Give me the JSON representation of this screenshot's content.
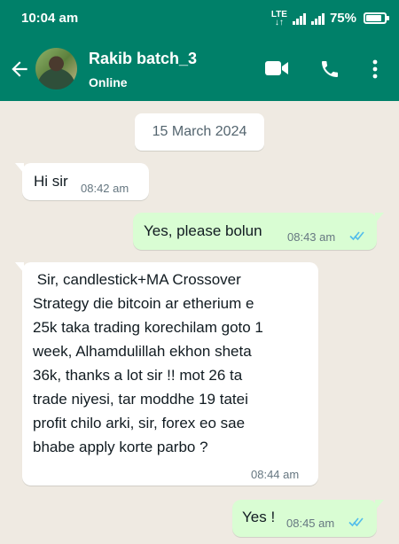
{
  "status_bar": {
    "time": "10:04 am",
    "network": "LTE",
    "battery": "75%",
    "battery_level": 0.75
  },
  "header": {
    "contact_name": "Rakib batch_3",
    "contact_status": "Online",
    "icons": [
      "back-arrow-icon",
      "video-call-icon",
      "phone-icon",
      "more-vertical-icon"
    ],
    "bar_color": "#008069"
  },
  "chat": {
    "date_label": "15 March 2024",
    "background_color": "#efeae2",
    "incoming_color": "#ffffff",
    "outgoing_color": "#d9fdd3",
    "read_tick_color": "#53bdeb",
    "messages": [
      {
        "direction": "incoming",
        "text": "Hi sir",
        "time": "08:42 am"
      },
      {
        "direction": "outgoing",
        "text": "Yes, please bolun",
        "time": "08:43 am",
        "status": "read"
      },
      {
        "direction": "incoming",
        "lines": [
          " Sir, candlestick+MA Crossover",
          "Strategy die bitcoin ar etherium e",
          "25k taka trading korechilam goto 1",
          "week, Alhamdulillah ekhon sheta",
          "36k, thanks a lot sir !! mot 26 ta",
          "trade niyesi, tar moddhe 19 tatei",
          "profit chilo arki, sir, forex eo sae",
          "bhabe apply korte parbo ?"
        ],
        "time": "08:44 am"
      },
      {
        "direction": "outgoing",
        "text": "Yes !",
        "time": "08:45 am",
        "status": "read"
      }
    ]
  }
}
